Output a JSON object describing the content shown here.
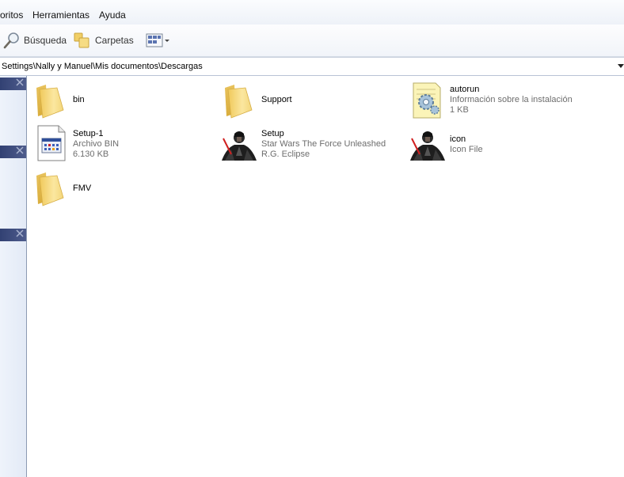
{
  "menu": {
    "items": [
      "oritos",
      "Herramientas",
      "Ayuda"
    ]
  },
  "toolbar": {
    "search_label": "Búsqueda",
    "folders_label": "Carpetas",
    "views_icon": "views-icon"
  },
  "address": {
    "path": "Settings\\Nally y Manuel\\Mis documentos\\Descargas"
  },
  "files": [
    {
      "name": "bin",
      "line2": "",
      "line3": "",
      "icon": "folder-icon"
    },
    {
      "name": "Support",
      "line2": "",
      "line3": "",
      "icon": "folder-icon"
    },
    {
      "name": "autorun",
      "line2": "Información sobre la instalación",
      "line3": "1 KB",
      "icon": "setup-info-icon"
    },
    {
      "name": "Setup-1",
      "line2": "Archivo BIN",
      "line3": "6.130 KB",
      "icon": "bin-file-icon"
    },
    {
      "name": "Setup",
      "line2": "Star Wars The Force Unleashed",
      "line3": "R.G. Eclipse",
      "icon": "game-character-icon"
    },
    {
      "name": "icon",
      "line2": "Icon File",
      "line3": "",
      "icon": "game-character-icon"
    },
    {
      "name": "FMV",
      "line2": "",
      "line3": "",
      "icon": "folder-icon"
    }
  ],
  "colors": {
    "pane_header": "#324173",
    "folder": "#f5d777",
    "subtext": "#6d6d6d"
  }
}
